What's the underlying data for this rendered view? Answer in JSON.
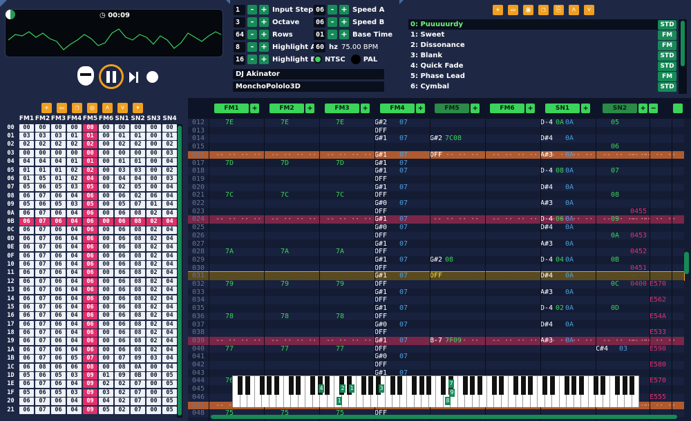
{
  "player": {
    "timer": "00:09"
  },
  "controls": [
    {
      "value": "1",
      "label": "Input Step"
    },
    {
      "value": "3",
      "label": "Octave"
    },
    {
      "value": "64",
      "label": "Rows"
    },
    {
      "value": "8",
      "label": "Highlight A"
    },
    {
      "value": "16",
      "label": "Highlight B"
    }
  ],
  "controls2": [
    {
      "value": "06",
      "label": "Speed A"
    },
    {
      "value": "06",
      "label": "Speed B"
    },
    {
      "value": "01",
      "label": "Base Time"
    }
  ],
  "tempo": {
    "hz": "60",
    "hz_unit": "hz",
    "bpm": "75.00 BPM",
    "ntsc": "NTSC",
    "pal": "PAL"
  },
  "song": {
    "author": "DJ Akinator",
    "title": "MonchoPololo3D"
  },
  "instrument_toolbar": [
    "+",
    "open",
    "save",
    "copy",
    "paste",
    "up",
    "down"
  ],
  "instruments": [
    {
      "name": "0: Puuuuurdy",
      "type": "STD",
      "selected": true
    },
    {
      "name": "1: Sweet",
      "type": "FM"
    },
    {
      "name": "2: Dissonance",
      "type": "FM"
    },
    {
      "name": "3: Blank",
      "type": "STD"
    },
    {
      "name": "4: Quick Fade",
      "type": "STD"
    },
    {
      "name": "5: Phase Lead",
      "type": "FM"
    },
    {
      "name": "6: Cymbal",
      "type": "STD"
    }
  ],
  "order_toolbar": [
    "+",
    "del",
    "copy",
    "dup",
    "up",
    "down",
    "more"
  ],
  "order_headers": [
    "FM1",
    "FM2",
    "FM3",
    "FM4",
    "FM5",
    "FM6",
    "SN1",
    "SN2",
    "SN3",
    "SN4"
  ],
  "orders": [
    [
      "00",
      "00",
      "00",
      "00",
      "00",
      "00",
      "00",
      "00",
      "00",
      "00",
      "00"
    ],
    [
      "01",
      "03",
      "03",
      "03",
      "01",
      "01",
      "00",
      "01",
      "01",
      "00",
      "01"
    ],
    [
      "02",
      "02",
      "02",
      "02",
      "02",
      "02",
      "00",
      "02",
      "02",
      "00",
      "02"
    ],
    [
      "03",
      "00",
      "00",
      "00",
      "00",
      "00",
      "00",
      "00",
      "00",
      "00",
      "03"
    ],
    [
      "04",
      "04",
      "04",
      "04",
      "01",
      "01",
      "00",
      "01",
      "01",
      "00",
      "04"
    ],
    [
      "05",
      "01",
      "01",
      "01",
      "02",
      "02",
      "00",
      "03",
      "03",
      "00",
      "02"
    ],
    [
      "06",
      "01",
      "05",
      "01",
      "02",
      "04",
      "00",
      "04",
      "04",
      "00",
      "03"
    ],
    [
      "07",
      "05",
      "06",
      "05",
      "03",
      "05",
      "00",
      "02",
      "05",
      "00",
      "04"
    ],
    [
      "08",
      "06",
      "07",
      "06",
      "04",
      "06",
      "00",
      "06",
      "02",
      "06",
      "04"
    ],
    [
      "09",
      "05",
      "06",
      "05",
      "03",
      "05",
      "00",
      "05",
      "07",
      "01",
      "04"
    ],
    [
      "0A",
      "06",
      "07",
      "06",
      "04",
      "06",
      "00",
      "06",
      "08",
      "02",
      "04"
    ],
    [
      "0B",
      "06",
      "07",
      "06",
      "04",
      "06",
      "00",
      "06",
      "08",
      "02",
      "04"
    ],
    [
      "0C",
      "06",
      "07",
      "06",
      "04",
      "06",
      "00",
      "06",
      "08",
      "02",
      "04"
    ],
    [
      "0D",
      "06",
      "07",
      "06",
      "04",
      "06",
      "00",
      "06",
      "08",
      "02",
      "04"
    ],
    [
      "0E",
      "06",
      "07",
      "06",
      "04",
      "06",
      "00",
      "06",
      "08",
      "02",
      "04"
    ],
    [
      "0F",
      "06",
      "07",
      "06",
      "04",
      "06",
      "00",
      "06",
      "08",
      "02",
      "04"
    ],
    [
      "10",
      "06",
      "07",
      "06",
      "04",
      "06",
      "00",
      "06",
      "08",
      "02",
      "04"
    ],
    [
      "11",
      "06",
      "07",
      "06",
      "04",
      "06",
      "00",
      "06",
      "08",
      "02",
      "04"
    ],
    [
      "12",
      "06",
      "07",
      "06",
      "04",
      "06",
      "00",
      "06",
      "08",
      "02",
      "04"
    ],
    [
      "13",
      "06",
      "07",
      "06",
      "04",
      "06",
      "00",
      "06",
      "08",
      "02",
      "04"
    ],
    [
      "14",
      "06",
      "07",
      "06",
      "04",
      "06",
      "00",
      "06",
      "08",
      "02",
      "04"
    ],
    [
      "15",
      "06",
      "07",
      "06",
      "04",
      "06",
      "00",
      "06",
      "08",
      "02",
      "04"
    ],
    [
      "16",
      "06",
      "07",
      "06",
      "04",
      "06",
      "00",
      "06",
      "08",
      "02",
      "04"
    ],
    [
      "17",
      "06",
      "07",
      "06",
      "04",
      "06",
      "00",
      "06",
      "08",
      "02",
      "04"
    ],
    [
      "18",
      "06",
      "07",
      "06",
      "04",
      "06",
      "00",
      "06",
      "08",
      "02",
      "04"
    ],
    [
      "19",
      "06",
      "07",
      "06",
      "04",
      "06",
      "00",
      "06",
      "08",
      "02",
      "04"
    ],
    [
      "1A",
      "06",
      "07",
      "06",
      "04",
      "06",
      "00",
      "06",
      "08",
      "02",
      "04"
    ],
    [
      "1B",
      "06",
      "07",
      "06",
      "05",
      "07",
      "00",
      "07",
      "09",
      "03",
      "04"
    ],
    [
      "1C",
      "06",
      "08",
      "06",
      "06",
      "08",
      "00",
      "08",
      "0A",
      "00",
      "04"
    ],
    [
      "1D",
      "05",
      "06",
      "05",
      "03",
      "09",
      "01",
      "09",
      "0B",
      "00",
      "05"
    ],
    [
      "1E",
      "06",
      "07",
      "06",
      "04",
      "09",
      "02",
      "02",
      "07",
      "00",
      "05"
    ],
    [
      "1F",
      "05",
      "06",
      "05",
      "03",
      "09",
      "03",
      "02",
      "07",
      "00",
      "05"
    ],
    [
      "20",
      "06",
      "07",
      "06",
      "04",
      "09",
      "04",
      "02",
      "07",
      "00",
      "05"
    ],
    [
      "21",
      "06",
      "07",
      "06",
      "04",
      "09",
      "05",
      "02",
      "07",
      "00",
      "05"
    ]
  ],
  "order_highlight_col": 5,
  "order_selected_row": "0B",
  "channels": [
    "FM1",
    "FM2",
    "FM3",
    "FM4",
    "FM5",
    "FM6",
    "SN1",
    "SN2"
  ],
  "pattern_rows": [
    {
      "n": "012",
      "fm1": "7E",
      "fm2": "7E",
      "fm3": "7E",
      "fm4n": "G#2",
      "fm4v": "07",
      "sn1n": "D-4",
      "sn1i": "0A",
      "sn1v": "0A",
      "sn2v": "05"
    },
    {
      "n": "013",
      "fm4n": "OFF"
    },
    {
      "n": "014",
      "fm4n": "G#1",
      "fm4v": "07",
      "fm5n": "G#2",
      "fm5v": "7C08",
      "sn1n": "D#4",
      "sn1v": "0A"
    },
    {
      "n": "015",
      "sn2v": "06"
    },
    {
      "n": "016",
      "hl": "orange",
      "fm4n": "G#1",
      "fm4v": "07",
      "fm5n": "OFF",
      "sn1n": "A#3",
      "sn1v": "0A"
    },
    {
      "n": "017",
      "fm1": "7D",
      "fm2": "7D",
      "fm3": "7D",
      "fm4n": "G#1",
      "fm4v": "07"
    },
    {
      "n": "018",
      "fm4n": "G#1",
      "fm4v": "07",
      "sn1n": "D-4",
      "sn1i": "08",
      "sn1v": "0A",
      "sn2v": "07"
    },
    {
      "n": "019",
      "fm4n": "OFF"
    },
    {
      "n": "020",
      "fm4n": "G#1",
      "fm4v": "07",
      "sn1n": "D#4",
      "sn1v": "0A"
    },
    {
      "n": "021",
      "fm1": "7C",
      "fm2": "7C",
      "fm3": "7C",
      "fm4n": "OFF",
      "sn2v": "08"
    },
    {
      "n": "022",
      "fm4n": "G#0",
      "fm4v": "07",
      "sn1n": "A#3",
      "sn1v": "0A"
    },
    {
      "n": "023",
      "fm4n": "OFF",
      "sn3v": "0455"
    },
    {
      "n": "024",
      "hl": "pink",
      "fm4n": "G#1",
      "fm4v": "07",
      "sn1n": "D-4",
      "sn1i": "06",
      "sn1v": "0A",
      "sn2v": "09"
    },
    {
      "n": "025",
      "fm4n": "G#0",
      "fm4v": "07",
      "sn1n": "D#4",
      "sn1v": "0A"
    },
    {
      "n": "026",
      "fm4n": "OFF",
      "sn2v": "0A",
      "sn3v": "0453"
    },
    {
      "n": "027",
      "fm4n": "G#1",
      "fm4v": "07",
      "sn1n": "A#3",
      "sn1v": "0A"
    },
    {
      "n": "028",
      "fm1": "7A",
      "fm2": "7A",
      "fm3": "7A",
      "fm4n": "OFF",
      "sn3v": "0452"
    },
    {
      "n": "029",
      "fm4n": "G#1",
      "fm4v": "07",
      "fm5n": "G#2",
      "fm5v": "08",
      "sn1n": "D-4",
      "sn1i": "04",
      "sn1v": "0A",
      "sn2v": "0B"
    },
    {
      "n": "030",
      "fm4n": "OFF",
      "sn3v": "0451"
    },
    {
      "n": "031",
      "hl": "cursor",
      "fm4n": "G#1",
      "fm4v": "07",
      "fm5n": "OFF",
      "sn1n": "D#4",
      "sn1v": "0A"
    },
    {
      "n": "032",
      "fm1": "79",
      "fm2": "79",
      "fm3": "79",
      "fm4n": "OFF",
      "sn2v": "0C",
      "sn3v": "0400",
      "sn4v": "E570"
    },
    {
      "n": "033",
      "fm4n": "G#1",
      "fm4v": "07",
      "sn1n": "A#3",
      "sn1v": "0A"
    },
    {
      "n": "034",
      "fm4n": "OFF",
      "sn4v": "E562"
    },
    {
      "n": "035",
      "fm4n": "G#1",
      "fm4v": "07",
      "sn1n": "D-4",
      "sn1i": "02",
      "sn1v": "0A",
      "sn2v": "0D"
    },
    {
      "n": "036",
      "fm1": "78",
      "fm2": "78",
      "fm3": "78",
      "fm4n": "OFF",
      "sn4v": "E54A"
    },
    {
      "n": "037",
      "fm4n": "G#0",
      "fm4v": "07",
      "sn1n": "D#4",
      "sn1v": "0A"
    },
    {
      "n": "038",
      "fm4n": "OFF",
      "sn4v": "E533"
    },
    {
      "n": "039",
      "hl": "pink",
      "fm4n": "G#1",
      "fm4v": "07",
      "fm5n": "B-7",
      "fm5v": "7F09",
      "sn1n": "A#3",
      "sn1v": "0A"
    },
    {
      "n": "040",
      "fm1": "77",
      "fm2": "77",
      "fm3": "77",
      "fm4n": "OFF",
      "sn2n": "C#4",
      "sn2i": "03",
      "sn4v": "E590"
    },
    {
      "n": "041",
      "fm4n": "G#0",
      "fm4v": "07"
    },
    {
      "n": "042",
      "fm4n": "OFF",
      "sn4v": "E580"
    },
    {
      "n": "043",
      "fm4n": "G#1",
      "fm4v": "07"
    },
    {
      "n": "044",
      "fm1": "76",
      "sn4v": "E570"
    },
    {
      "n": "045"
    },
    {
      "n": "046",
      "sn4v": "E555"
    },
    {
      "n": "047",
      "hl": "orange"
    },
    {
      "n": "048",
      "fm1": "75",
      "fm2": "75",
      "fm3": "75",
      "fm4n": "OFF"
    }
  ],
  "piano_marks": [
    "4",
    "1",
    "2",
    "1",
    "3",
    "7",
    "9",
    "8"
  ],
  "colors": {
    "accent": "#3bd45a",
    "highlight": "#e0306c",
    "orange": "#f0a020"
  }
}
